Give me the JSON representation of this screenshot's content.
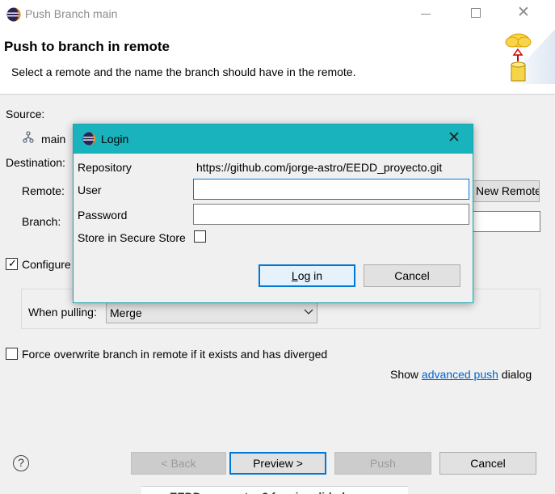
{
  "window": {
    "title": "Push Branch main",
    "minimize_icon": "minimize-icon",
    "maximize_icon": "maximize-icon",
    "close_glyph": "✕"
  },
  "header": {
    "title": "Push to branch in remote",
    "description": "Select a remote and the name the branch should have in the remote."
  },
  "form": {
    "source_label": "Source:",
    "source_branch": "main",
    "destination_label": "Destination:",
    "remote_label": "Remote:",
    "new_remote_label": "New Remote...",
    "branch_label": "Branch:",
    "branch_value": "",
    "configure_label": "Configure",
    "configure_checked": true,
    "when_pulling_label": "When pulling:",
    "when_pulling_value": "Merge",
    "force_label": "Force overwrite branch in remote if it exists and has diverged",
    "force_checked": false,
    "show_prefix": "Show ",
    "advanced_link": "advanced push",
    "show_suffix": " dialog"
  },
  "footer": {
    "help_glyph": "?",
    "back_label": "< Back",
    "preview_label": "Preview >",
    "push_label": "Push",
    "cancel_label": "Cancel"
  },
  "taskbar": {
    "partial_text": "EEDD_proyecto: 3 funcionalidad"
  },
  "login": {
    "title": "Login",
    "close_glyph": "✕",
    "repository_label": "Repository",
    "repository_value": "https://github.com/jorge-astro/EEDD_proyecto.git",
    "user_label": "User",
    "user_value": "",
    "password_label": "Password",
    "password_value": "",
    "store_label": "Store in Secure Store",
    "store_checked": false,
    "login_mnemonic": "L",
    "login_rest": "og in",
    "cancel_label": "Cancel"
  },
  "colors": {
    "login_titlebar": "#19b3bd",
    "focus_border": "#0078d7",
    "link": "#0066cc"
  }
}
